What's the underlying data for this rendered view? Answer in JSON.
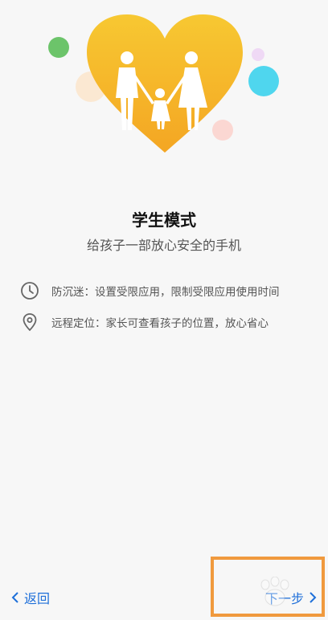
{
  "hero": {
    "image": "family-heart-illustration"
  },
  "title": "学生模式",
  "subtitle": "给孩子一部放心安全的手机",
  "features": [
    {
      "icon": "clock-icon",
      "text": "防沉迷：设置受限应用，限制受限应用使用时间"
    },
    {
      "icon": "location-pin-icon",
      "text": "远程定位：家长可查看孩子的位置，放心省心"
    }
  ],
  "nav": {
    "back_label": "返回",
    "next_label": "下一步"
  },
  "colors": {
    "accent": "#1e6fd9",
    "heart": "#f6bf26",
    "highlight": "#f09a3e"
  }
}
